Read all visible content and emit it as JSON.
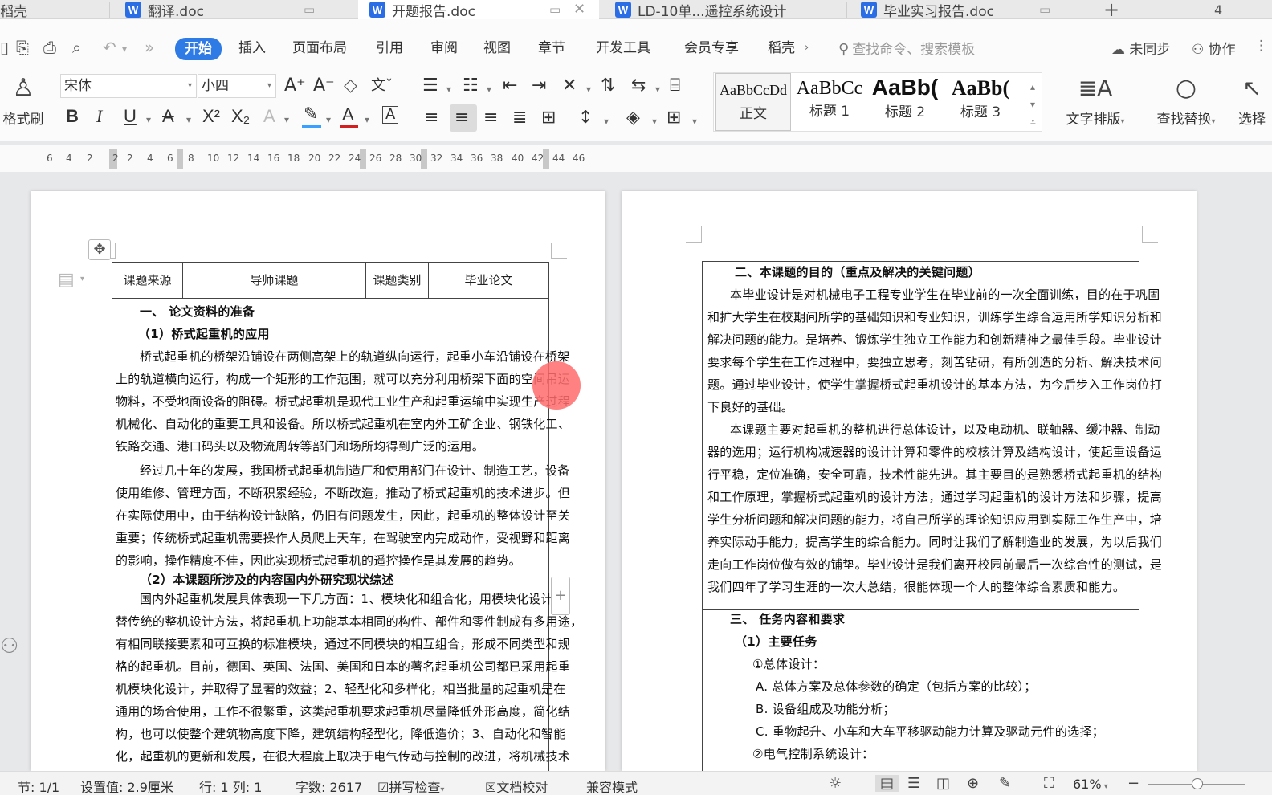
{
  "tabs": [
    {
      "label": "稻壳",
      "active": false
    },
    {
      "label": "翻译.doc",
      "active": false
    },
    {
      "label": "开题报告.doc",
      "active": true
    },
    {
      "label": "LD-10单...遥控系统设计",
      "active": false
    },
    {
      "label": "毕业实习报告.doc",
      "active": false
    }
  ],
  "tab_add": "+",
  "tab_count": "4",
  "menu": {
    "items": [
      "开始",
      "插入",
      "页面布局",
      "引用",
      "审阅",
      "视图",
      "章节",
      "开发工具",
      "会员专享",
      "稻壳"
    ],
    "search_placeholder": "查找命令、搜索模板",
    "sync": "未同步",
    "collab": "协作"
  },
  "ribbon": {
    "format_painter": "格式刷",
    "font_name": "宋体",
    "font_size": "小四",
    "styles": [
      {
        "sample": "AaBbCcDd",
        "name": "正文"
      },
      {
        "sample": "AaBbCc",
        "name": "标题 1"
      },
      {
        "sample": "AaBb(",
        "name": "标题 2"
      },
      {
        "sample": "AaBb(",
        "name": "标题 3"
      }
    ],
    "text_layout": "文字排版",
    "find_replace": "查找替换",
    "select": "选择"
  },
  "ruler": {
    "numbers": [
      "6",
      "4",
      "2",
      "2",
      "2",
      "4",
      "6",
      "8",
      "10",
      "12",
      "14",
      "16",
      "18",
      "20",
      "22",
      "24",
      "26",
      "28",
      "30",
      "32",
      "34",
      "36",
      "38",
      "40",
      "42",
      "44",
      "46"
    ]
  },
  "page_left": {
    "header_cells": [
      "课题来源",
      "导师课题",
      "课题类别",
      "毕业论文"
    ],
    "lines": [
      {
        "text": "一、  论文资料的准备",
        "bold": true
      },
      {
        "text": "（1）桥式起重机的应用",
        "bold": true
      },
      {
        "text": "桥式起重机的桥架沿铺设在两侧高架上的轨道纵向运行，起重小车沿铺设在桥架",
        "bold": false
      },
      {
        "text": "上的轨道横向运行，构成一个矩形的工作范围，就可以充分利用桥架下面的空间吊运",
        "bold": false
      },
      {
        "text": "物料，不受地面设备的阻碍。桥式起重机是现代工业生产和起重运输中实现生产过程",
        "bold": false
      },
      {
        "text": "机械化、自动化的重要工具和设备。所以桥式起重机在室内外工矿企业、钢铁化工、",
        "bold": false
      },
      {
        "text": "铁路交通、港口码头以及物流周转等部门和场所均得到广泛的运用。",
        "bold": false
      },
      {
        "text": "经过几十年的发展，我国桥式起重机制造厂和使用部门在设计、制造工艺，设备",
        "bold": false
      },
      {
        "text": "使用维修、管理方面，不断积累经验，不断改造，推动了桥式起重机的技术进步。但",
        "bold": false
      },
      {
        "text": "在实际使用中，由于结构设计缺陷，仍旧有问题发生，因此，起重机的整体设计至关",
        "bold": false
      },
      {
        "text": "重要；传统桥式起重机需要操作人员爬上天车，在驾驶室内完成动作，受视野和距离",
        "bold": false
      },
      {
        "text": "的影响，操作精度不佳，因此实现桥式起重机的遥控操作是其发展的趋势。",
        "bold": false
      },
      {
        "text": "（2）本课题所涉及的内容国内外研究现状综述",
        "bold": true
      },
      {
        "text": "国内外起重机发展具体表现一下几方面：1、模块化和组合化，用模块化设计代",
        "bold": false
      },
      {
        "text": "替传统的整机设计方法，将起重机上功能基本相同的构件、部件和零件制成有多用途，",
        "bold": false
      },
      {
        "text": "有相同联接要素和可互换的标准模块，通过不同模块的相互组合，形成不同类型和规",
        "bold": false
      },
      {
        "text": "格的起重机。目前，德国、英国、法国、美国和日本的著名起重机公司都已采用起重",
        "bold": false
      },
      {
        "text": "机模块化设计，并取得了显著的效益；2、轻型化和多样化，相当批量的起重机是在",
        "bold": false
      },
      {
        "text": "通用的场合使用，工作不很繁重，这类起重机要求起重机尽量降低外形高度，简化结",
        "bold": false
      },
      {
        "text": "构，也可以使整个建筑物高度下降，建筑结构轻型化，降低造价；3、自动化和智能",
        "bold": false
      },
      {
        "text": "化，起重机的更新和发展，在很大程度上取决于电气传动与控制的改进，将机械技术",
        "bold": false
      }
    ]
  },
  "page_right": {
    "lines": [
      {
        "text": "二、本课题的目的（重点及解决的关键问题）",
        "bold": true
      },
      {
        "text": "本毕业设计是对机械电子工程专业学生在毕业前的一次全面训练，目的在于巩固",
        "bold": false
      },
      {
        "text": "和扩大学生在校期间所学的基础知识和专业知识，训练学生综合运用所学知识分析和",
        "bold": false
      },
      {
        "text": "解决问题的能力。是培养、锻炼学生独立工作能力和创新精神之最佳手段。毕业设计",
        "bold": false
      },
      {
        "text": "要求每个学生在工作过程中，要独立思考，刻苦钻研，有所创造的分析、解决技术问",
        "bold": false
      },
      {
        "text": "题。通过毕业设计，使学生掌握桥式起重机设计的基本方法，为今后步入工作岗位打",
        "bold": false
      },
      {
        "text": "下良好的基础。",
        "bold": false
      },
      {
        "text": "本课题主要对起重机的整机进行总体设计，以及电动机、联轴器、缓冲器、制动",
        "bold": false
      },
      {
        "text": "器的选用；运行机构减速器的设计计算和零件的校核计算及结构设计，使起重设备运",
        "bold": false
      },
      {
        "text": "行平稳，定位准确，安全可靠，技术性能先进。其主要目的是熟悉桥式起重机的结构",
        "bold": false
      },
      {
        "text": "和工作原理，掌握桥式起重机的设计方法，通过学习起重机的设计方法和步骤，提高",
        "bold": false
      },
      {
        "text": "学生分析问题和解决问题的能力，将自己所学的理论知识应用到实际工作生产中，培",
        "bold": false
      },
      {
        "text": "养实际动手能力，提高学生的综合能力。同时让我们了解制造业的发展，为以后我们",
        "bold": false
      },
      {
        "text": "走向工作岗位做有效的铺垫。毕业设计是我们离开校园前最后一次综合性的测试，是",
        "bold": false
      },
      {
        "text": "我们四年了学习生涯的一次大总结，很能体现一个人的整体综合素质和能力。",
        "bold": false
      },
      {
        "text": "三、 任务内容和要求",
        "bold": true
      },
      {
        "text": "（1）主要任务",
        "bold": true
      },
      {
        "text": "①总体设计：",
        "bold": false
      },
      {
        "text": "A. 总体方案及总体参数的确定（包括方案的比较）；",
        "bold": false
      },
      {
        "text": "B. 设备组成及功能分析；",
        "bold": false
      },
      {
        "text": "C. 重物起升、小车和大车平移驱动能力计算及驱动元件的选择；",
        "bold": false
      },
      {
        "text": "②电气控制系统设计：",
        "bold": false
      }
    ]
  },
  "status": {
    "section": "节: 1/1",
    "setting": "设置值: 2.9厘米",
    "rowcol": "行: 1   列: 1",
    "wordcount": "字数: 2617",
    "spellcheck": "拼写检查",
    "proofread": "文档校对",
    "compat": "兼容模式",
    "zoom": "61%"
  },
  "colors": {
    "accent": "#2f7be5",
    "cursor_dot": "#ff6b6b"
  }
}
